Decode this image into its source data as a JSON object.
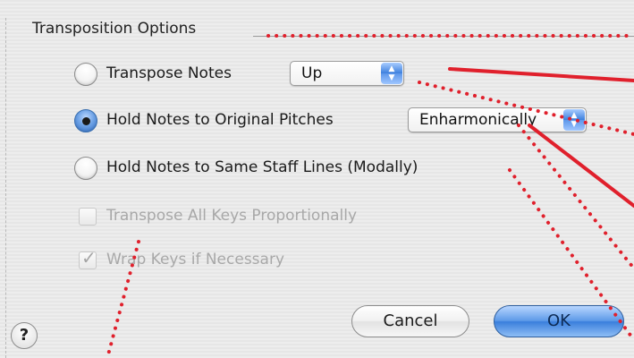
{
  "group": {
    "title": "Transposition Options"
  },
  "options": {
    "transpose_notes": {
      "label": "Transpose Notes",
      "selected": false,
      "direction_value": "Up"
    },
    "hold_original": {
      "label": "Hold Notes to Original Pitches",
      "selected": true,
      "method_value": "Enharmonically"
    },
    "hold_staff": {
      "label": "Hold Notes to Same Staff Lines (Modally)",
      "selected": false
    }
  },
  "checkboxes": {
    "transpose_keys": {
      "label": "Transpose All Keys Proportionally",
      "checked": false,
      "enabled": false
    },
    "wrap_keys": {
      "label": "Wrap Keys if Necessary",
      "checked": true,
      "enabled": false
    }
  },
  "buttons": {
    "help": "?",
    "cancel": "Cancel",
    "ok": "OK"
  },
  "icons": {
    "popup_arrows": "up-down-arrows-icon",
    "checkmark": "checkmark-icon"
  },
  "colors": {
    "annotation": "#e0202c",
    "accent": "#3a7fdc"
  }
}
